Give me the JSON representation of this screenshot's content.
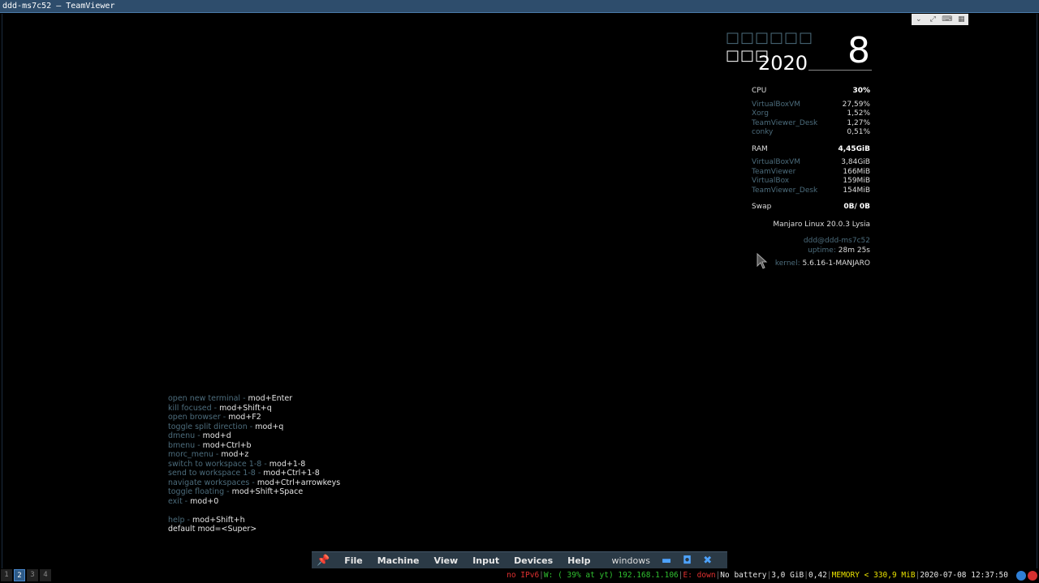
{
  "window": {
    "title": "ddd-ms7c52 — TeamViewer"
  },
  "teamviewer_widget": {
    "icons": [
      "chevron-down-icon",
      "fullscreen-icon",
      "keyboard-icon",
      "grid-icon"
    ]
  },
  "conky": {
    "date_top": "□□□□□□",
    "date_mid": "□□□",
    "year": "2020",
    "day": "8",
    "cpu": {
      "label": "CPU",
      "value": "30%",
      "procs": [
        {
          "name": "VirtualBoxVM",
          "value": "27,59%"
        },
        {
          "name": "Xorg",
          "value": "1,52%"
        },
        {
          "name": "TeamViewer_Desk",
          "value": "1,27%"
        },
        {
          "name": "conky",
          "value": "0,51%"
        }
      ]
    },
    "ram": {
      "label": "RAM",
      "value": "4,45GiB",
      "procs": [
        {
          "name": "VirtualBoxVM",
          "value": "3,84GiB"
        },
        {
          "name": "TeamViewer",
          "value": "166MiB"
        },
        {
          "name": "VirtualBox",
          "value": "159MiB"
        },
        {
          "name": "TeamViewer_Desk",
          "value": "154MiB"
        }
      ]
    },
    "swap": {
      "label": "Swap",
      "value": "0B/ 0B"
    },
    "os": "Manjaro Linux 20.0.3 Lysia",
    "user": "ddd@ddd-ms7c52",
    "uptime_label": "uptime:",
    "uptime": "28m 25s",
    "kernel_label": "kernel:",
    "kernel": "5.6.16-1-MANJARO"
  },
  "help": [
    {
      "k": "open new terminal - ",
      "v": "mod+Enter"
    },
    {
      "k": "kill focused - ",
      "v": "mod+Shift+q"
    },
    {
      "k": "open browser - ",
      "v": "mod+F2"
    },
    {
      "k": "toggle split direction - ",
      "v": "mod+q"
    },
    {
      "k": "dmenu - ",
      "v": "mod+d"
    },
    {
      "k": "bmenu - ",
      "v": "mod+Ctrl+b"
    },
    {
      "k": "morc_menu - ",
      "v": "mod+z"
    },
    {
      "k": "switch to workspace 1-8 - ",
      "v": "mod+1-8"
    },
    {
      "k": "send to workspace 1-8 - ",
      "v": "mod+Ctrl+1-8"
    },
    {
      "k": "navigate workspaces - ",
      "v": "mod+Ctrl+arrowkeys"
    },
    {
      "k": "toggle floating - ",
      "v": "mod+Shift+Space"
    },
    {
      "k": "exit - ",
      "v": "mod+0"
    },
    {
      "k": "",
      "v": ""
    },
    {
      "k": "help - ",
      "v": "mod+Shift+h"
    },
    {
      "k": "",
      "v": "default mod=<Super>"
    }
  ],
  "vbox_bar": {
    "pin": "📌",
    "menus": [
      "File",
      "Machine",
      "View",
      "Input",
      "Devices",
      "Help"
    ],
    "window_label": "windows",
    "minimize": "▬",
    "restore": "◘",
    "close": "✖"
  },
  "workspaces": [
    "1",
    "2",
    "3",
    "4"
  ],
  "active_workspace": "2",
  "status": {
    "ipv6": "no IPv6",
    "wifi": "W: ( 39% at yt) 192.168.1.106",
    "eth": "E: down",
    "battery": "No battery",
    "disk": "3,0 GiB",
    "load": "0,42",
    "memory": "MEMORY < 330,9 MiB",
    "datetime": "2020-07-08 12:37:50"
  },
  "colors": {
    "accent": "#2e4d6c",
    "dim_text": "#4c6c7c",
    "warning": "#e03030",
    "ok": "#30c030",
    "mem": "#e8e000"
  }
}
